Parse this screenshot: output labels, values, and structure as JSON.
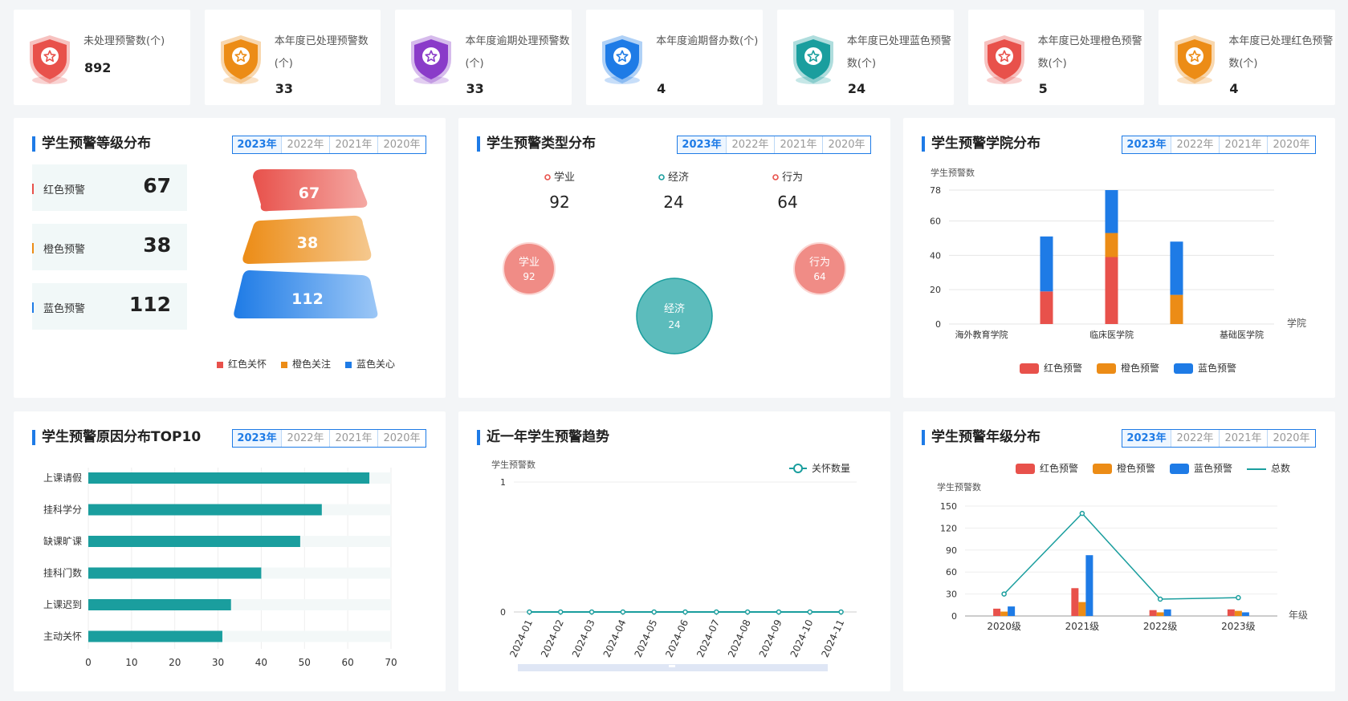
{
  "stats": [
    {
      "label": "未处理预警数(个)",
      "value": "892",
      "color": "#e8514b"
    },
    {
      "label": "本年度已处理预警数(个)",
      "value": "33",
      "color": "#ec8c16"
    },
    {
      "label": "本年度逾期处理预警数(个)",
      "value": "33",
      "color": "#8a3bc9"
    },
    {
      "label": "本年度逾期督办数(个)",
      "value": "4",
      "color": "#1e7be6"
    },
    {
      "label": "本年度已处理蓝色预警数(个)",
      "value": "24",
      "color": "#1a9e9e"
    },
    {
      "label": "本年度已处理橙色预警数(个)",
      "value": "5",
      "color": "#e8514b"
    },
    {
      "label": "本年度已处理红色预警数(个)",
      "value": "4",
      "color": "#ec8c16"
    }
  ],
  "years": [
    "2023年",
    "2022年",
    "2021年",
    "2020年"
  ],
  "level": {
    "title": "学生预警等级分布",
    "rows": [
      {
        "name": "红色预警",
        "value": "67",
        "color": "#e8514b"
      },
      {
        "name": "橙色预警",
        "value": "38",
        "color": "#ec8c16"
      },
      {
        "name": "蓝色预警",
        "value": "112",
        "color": "#1e7be6"
      }
    ],
    "legend": [
      "红色关怀",
      "橙色关注",
      "蓝色关心"
    ],
    "colors": {
      "red": "#e8514b",
      "orange": "#ec8c16",
      "blue": "#1e7be6"
    }
  },
  "type_dist": {
    "title": "学生预警类型分布",
    "items": [
      {
        "name": "学业",
        "value": "92",
        "color": "#e8514b"
      },
      {
        "name": "经济",
        "value": "24",
        "color": "#1a9e9e"
      },
      {
        "name": "行为",
        "value": "64",
        "color": "#e8514b"
      }
    ]
  },
  "college": {
    "title": "学生预警学院分布",
    "ylabel": "学生预警数",
    "xlabel": "学院",
    "legend": [
      "红色预警",
      "橙色预警",
      "蓝色预警"
    ]
  },
  "reason": {
    "title": "学生预警原因分布TOP10"
  },
  "trend": {
    "title": "近一年学生预警趋势",
    "ylabel": "学生预警数",
    "legend": "关怀数量"
  },
  "grade": {
    "title": "学生预警年级分布",
    "ylabel": "学生预警数",
    "xlabel": "年级",
    "legend": [
      "红色预警",
      "橙色预警",
      "蓝色预警",
      "总数"
    ]
  },
  "chart_data": [
    {
      "id": "level",
      "type": "funnel",
      "categories": [
        "红色关怀",
        "橙色关注",
        "蓝色关心"
      ],
      "values": [
        67,
        38,
        112
      ]
    },
    {
      "id": "type",
      "type": "bubble",
      "categories": [
        "学业",
        "经济",
        "行为"
      ],
      "values": [
        92,
        24,
        64
      ]
    },
    {
      "id": "college",
      "type": "bar",
      "stacked": true,
      "ylabel": "学生预警数",
      "xlabel": "学院",
      "ylim": [
        0,
        80
      ],
      "yticks": [
        0,
        20,
        40,
        60,
        78
      ],
      "categories": [
        "海外教育学院",
        "",
        "临床医学院",
        "",
        "基础医学院"
      ],
      "series": [
        {
          "name": "红色预警",
          "color": "#e8514b",
          "values": [
            0,
            19,
            39,
            0,
            0
          ]
        },
        {
          "name": "橙色预警",
          "color": "#ec8c16",
          "values": [
            0,
            0,
            14,
            17,
            0
          ]
        },
        {
          "name": "蓝色预警",
          "color": "#1e7be6",
          "values": [
            0,
            32,
            25,
            31,
            0
          ]
        }
      ],
      "tick_labels": [
        "海外教育学院",
        "临床医学院",
        "基础医学院"
      ]
    },
    {
      "id": "reason",
      "type": "bar",
      "orientation": "horizontal",
      "xlim": [
        0,
        70
      ],
      "xticks": [
        0,
        10,
        20,
        30,
        40,
        50,
        60,
        70
      ],
      "categories": [
        "上课请假",
        "挂科学分",
        "缺课旷课",
        "挂科门数",
        "上课迟到",
        "主动关怀"
      ],
      "values": [
        65,
        54,
        49,
        40,
        33,
        31
      ],
      "color": "#1a9e9e"
    },
    {
      "id": "trend",
      "type": "line",
      "ylabel": "学生预警数",
      "ylim": [
        0,
        1
      ],
      "yticks": [
        0,
        1
      ],
      "x": [
        "2024-01",
        "2024-02",
        "2024-03",
        "2024-04",
        "2024-05",
        "2024-06",
        "2024-07",
        "2024-08",
        "2024-09",
        "2024-10",
        "2024-11"
      ],
      "series": [
        {
          "name": "关怀数量",
          "color": "#1a9e9e",
          "values": [
            0,
            0,
            0,
            0,
            0,
            0,
            0,
            0,
            0,
            0,
            0
          ]
        }
      ]
    },
    {
      "id": "grade",
      "type": "bar",
      "ylabel": "学生预警数",
      "xlabel": "年级",
      "ylim": [
        0,
        150
      ],
      "yticks": [
        0,
        30,
        60,
        90,
        120,
        150
      ],
      "categories": [
        "2020级",
        "2021级",
        "2022级",
        "2023级"
      ],
      "series": [
        {
          "name": "红色预警",
          "color": "#e8514b",
          "values": [
            10,
            38,
            8,
            9
          ]
        },
        {
          "name": "橙色预警",
          "color": "#ec8c16",
          "values": [
            6,
            19,
            5,
            7
          ]
        },
        {
          "name": "蓝色预警",
          "color": "#1e7be6",
          "values": [
            13,
            83,
            9,
            5
          ]
        },
        {
          "name": "总数",
          "type": "line",
          "color": "#1a9e9e",
          "values": [
            30,
            140,
            23,
            25
          ]
        }
      ]
    }
  ]
}
